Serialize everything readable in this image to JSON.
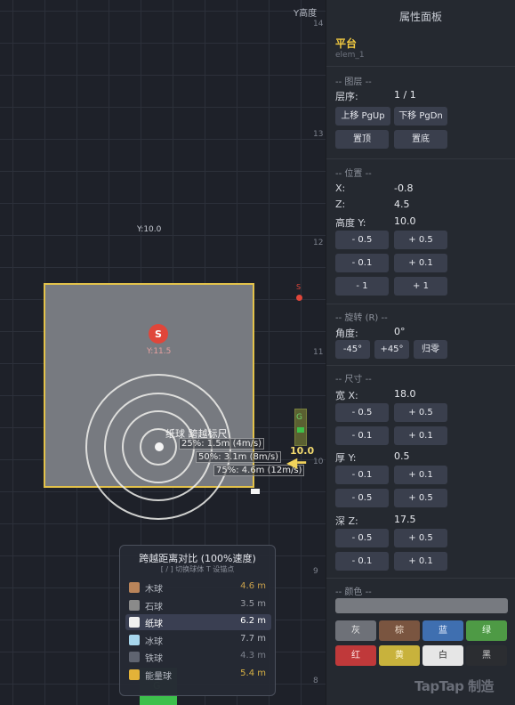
{
  "viewport": {
    "ruler_title": "Y高度",
    "ruler_ticks": [
      "14",
      "13",
      "12",
      "11",
      "10",
      "9",
      "8"
    ],
    "y_label": "Y:10.0",
    "platform": {
      "color": "#777a80",
      "border_color": "#e3c24a"
    },
    "spawn": {
      "letter": "S",
      "y_label": "Y:11.5"
    },
    "side_spawn_letter": "S",
    "range": {
      "title": "纸球 跨越标尺",
      "rings": [
        {
          "label": "25%: 1.5m (4m/s)"
        },
        {
          "label": "50%: 3.1m (8m/s)"
        },
        {
          "label": "75%: 4.6m (12m/s)"
        }
      ]
    },
    "goal_letter": "G",
    "height_marker": "10.0",
    "arrow": "◀━"
  },
  "compare": {
    "title": "跨越距离对比 (100%速度)",
    "subtitle": "[ / ] 切换球体  T 设锚点",
    "rows": [
      {
        "name": "木球",
        "value": "4.6 m",
        "swatch": "#b9845a",
        "value_color": "#c9a04b"
      },
      {
        "name": "石球",
        "value": "3.5 m",
        "swatch": "#8a8a8a",
        "value_color": "#9b9ea6"
      },
      {
        "name": "纸球",
        "value": "6.2 m",
        "swatch": "#f0f0f0",
        "value_color": "#ffffff",
        "selected": true
      },
      {
        "name": "冰球",
        "value": "7.7 m",
        "swatch": "#a7d6ec",
        "value_color": "#b6bac3"
      },
      {
        "name": "铁球",
        "value": "4.3 m",
        "swatch": "#5f6470",
        "value_color": "#7c818c"
      },
      {
        "name": "能量球",
        "value": "5.4 m",
        "swatch": "#e3b238",
        "value_color": "#d9b244"
      }
    ]
  },
  "props": {
    "title": "属性面板",
    "element_name": "平台",
    "element_id": "elem_1",
    "layer": {
      "section": "-- 图层 --",
      "order_label": "层序:",
      "order_value": "1 / 1",
      "btn_up": "上移 PgUp",
      "btn_down": "下移 PgDn",
      "btn_top": "置顶",
      "btn_bottom": "置底"
    },
    "position": {
      "section": "-- 位置 --",
      "x_label": "X:",
      "x_value": "-0.8",
      "z_label": "Z:",
      "z_value": "4.5",
      "h_label": "高度 Y:",
      "h_value": "10.0",
      "buttons": [
        "- 0.5",
        "+ 0.5",
        "- 0.1",
        "+ 0.1",
        "- 1",
        "+ 1"
      ]
    },
    "rotation": {
      "section": "-- 旋转 (R) --",
      "angle_label": "角度:",
      "angle_value": "0°",
      "btn_minus": "-45°",
      "btn_plus": "+45°",
      "btn_reset": "归零"
    },
    "size": {
      "section": "-- 尺寸 --",
      "w_label": "宽 X:",
      "w_value": "18.0",
      "t_label": "厚 Y:",
      "t_value": "0.5",
      "d_label": "深 Z:",
      "d_value": "17.5",
      "w_buttons": [
        "- 0.5",
        "+ 0.5",
        "- 0.1",
        "+ 0.1"
      ],
      "t_buttons": [
        "- 0.1",
        "+ 0.1",
        "- 0.5",
        "+ 0.5"
      ],
      "d_buttons": [
        "- 0.5",
        "+ 0.5",
        "- 0.1",
        "+ 0.1"
      ]
    },
    "color": {
      "section": "-- 颜色 --",
      "current": "#777a80",
      "swatches": [
        {
          "label": "灰",
          "bg": "#6e7178",
          "fg": "#e6e6e6"
        },
        {
          "label": "棕",
          "bg": "#7a5540",
          "fg": "#f0e0d0"
        },
        {
          "label": "蓝",
          "bg": "#3f6fb0",
          "fg": "#e8f0ff"
        },
        {
          "label": "绿",
          "bg": "#4e9a45",
          "fg": "#e8ffe8"
        },
        {
          "label": "红",
          "bg": "#c0393a",
          "fg": "#ffe8e8"
        },
        {
          "label": "黄",
          "bg": "#c8b23c",
          "fg": "#fff8d8"
        },
        {
          "label": "白",
          "bg": "#e6e6e6",
          "fg": "#333333"
        },
        {
          "label": "黑",
          "bg": "#2b2d31",
          "fg": "#d0d0d0"
        }
      ]
    }
  },
  "watermark": "TapTap 制造"
}
